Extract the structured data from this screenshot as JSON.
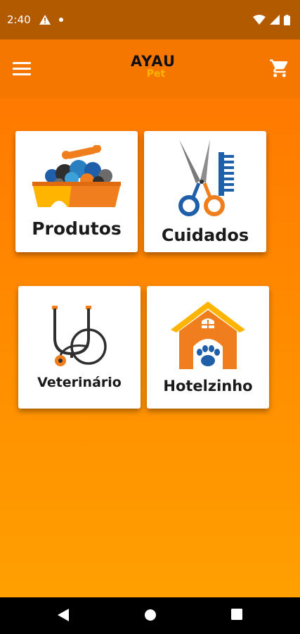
{
  "status_bar": {
    "time": "2:40",
    "icons": [
      "warning-icon",
      "dot-icon",
      "wifi-icon",
      "signal-icon",
      "battery-icon"
    ]
  },
  "app_bar": {
    "logo_main": "AYAU",
    "logo_sub": "Pet",
    "menu_icon": "hamburger-menu-icon",
    "cart_icon": "shopping-cart-icon"
  },
  "categories": [
    {
      "label": "Produtos",
      "icon": "pet-food-bowl-icon"
    },
    {
      "label": "Cuidados",
      "icon": "scissors-comb-icon"
    },
    {
      "label": "Veterinário",
      "icon": "stethoscope-icon"
    },
    {
      "label": "Hotelzinho",
      "icon": "dog-house-icon"
    }
  ],
  "nav_bar": {
    "back_icon": "back-triangle-icon",
    "home_icon": "home-circle-icon",
    "recents_icon": "recents-square-icon"
  },
  "colors": {
    "status_bar": "#b25a00",
    "app_bar": "#f57700",
    "background_top": "#ff7a00",
    "background_bottom": "#ffa000",
    "accent_orange": "#f07e1c",
    "accent_blue": "#1f5ea8"
  }
}
